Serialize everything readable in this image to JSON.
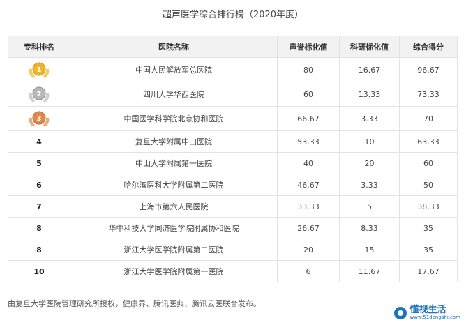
{
  "page": {
    "title": "超声医学综合排行榜（2020年度）"
  },
  "table": {
    "headers": {
      "rank": "专科排名",
      "hospital": "医院名称",
      "reputation": "声誉标化值",
      "research": "科研标化值",
      "total": "综合得分"
    },
    "rows": [
      {
        "rank": "1",
        "medal": "gold",
        "hospital": "中国人民解放军总医院",
        "reputation": "80",
        "research": "16.67",
        "total": "96.67"
      },
      {
        "rank": "2",
        "medal": "silver",
        "hospital": "四川大学华西医院",
        "reputation": "60",
        "research": "13.33",
        "total": "73.33"
      },
      {
        "rank": "3",
        "medal": "bronze",
        "hospital": "中国医学科学院北京协和医院",
        "reputation": "66.67",
        "research": "3.33",
        "total": "70"
      },
      {
        "rank": "4",
        "hospital": "复旦大学附属中山医院",
        "reputation": "53.33",
        "research": "10",
        "total": "63.33"
      },
      {
        "rank": "5",
        "hospital": "中山大学附属第一医院",
        "reputation": "40",
        "research": "20",
        "total": "60"
      },
      {
        "rank": "6",
        "hospital": "哈尔滨医科大学附属第二医院",
        "reputation": "46.67",
        "research": "3.33",
        "total": "50"
      },
      {
        "rank": "7",
        "hospital": "上海市第六人民医院",
        "reputation": "33.33",
        "research": "5",
        "total": "38.33"
      },
      {
        "rank": "8",
        "hospital": "华中科技大学同济医学院附属协和医院",
        "reputation": "26.67",
        "research": "8.33",
        "total": "35"
      },
      {
        "rank": "8",
        "hospital": "浙江大学医学院附属第二医院",
        "reputation": "20",
        "research": "15",
        "total": "35"
      },
      {
        "rank": "10",
        "hospital": "浙江大学医学院附属第一医院",
        "reputation": "6",
        "research": "11.67",
        "total": "17.67"
      }
    ]
  },
  "footnote": "由复旦大学医院管理研究所授权，健康界、腾讯医典、腾讯云医联合发布。",
  "watermark": {
    "text": "懂视生活",
    "url": "www.51dongshi.com"
  },
  "colors": {
    "gold": "#f0b429",
    "silver": "#b8b8b8",
    "bronze": "#e0894a",
    "header_bg": "#f2f2f2",
    "border": "#e3e3e3"
  }
}
